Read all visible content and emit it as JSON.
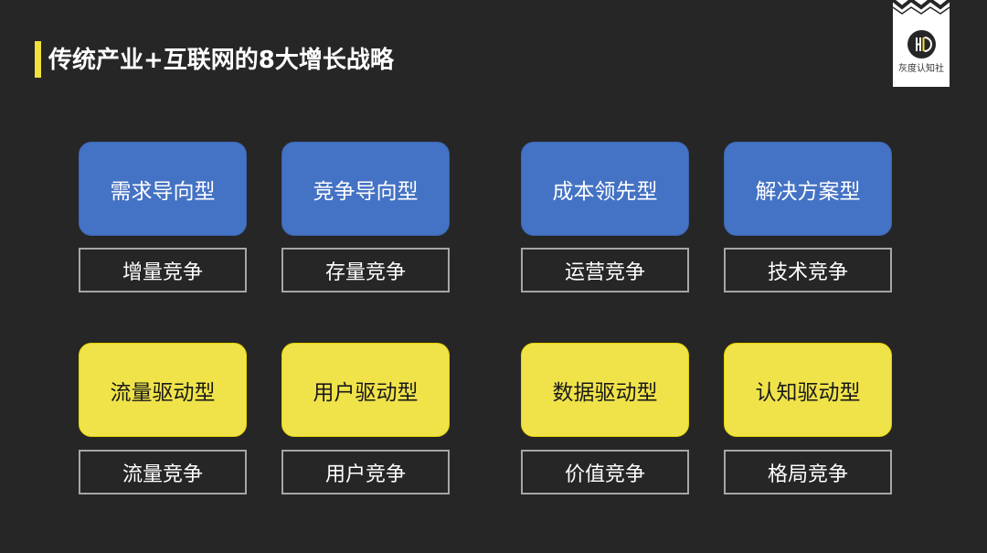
{
  "header": {
    "title": "传统产业+互联网的8大增长战略",
    "accent_color": "#f0e23a"
  },
  "logo": {
    "text": "灰度认知社",
    "mark": "HD"
  },
  "colors": {
    "background": "#262626",
    "blue_card": "#4472c4",
    "yellow_card": "#f0e34a",
    "tag_border": "#a6a6a6"
  },
  "strategies": [
    {
      "type": "需求导向型",
      "competition": "增量竞争",
      "color": "blue"
    },
    {
      "type": "竞争导向型",
      "competition": "存量竞争",
      "color": "blue"
    },
    {
      "type": "成本领先型",
      "competition": "运营竞争",
      "color": "blue"
    },
    {
      "type": "解决方案型",
      "competition": "技术竞争",
      "color": "blue"
    },
    {
      "type": "流量驱动型",
      "competition": "流量竞争",
      "color": "yellow"
    },
    {
      "type": "用户驱动型",
      "competition": "用户竞争",
      "color": "yellow"
    },
    {
      "type": "数据驱动型",
      "competition": "价值竞争",
      "color": "yellow"
    },
    {
      "type": "认知驱动型",
      "competition": "格局竞争",
      "color": "yellow"
    }
  ]
}
